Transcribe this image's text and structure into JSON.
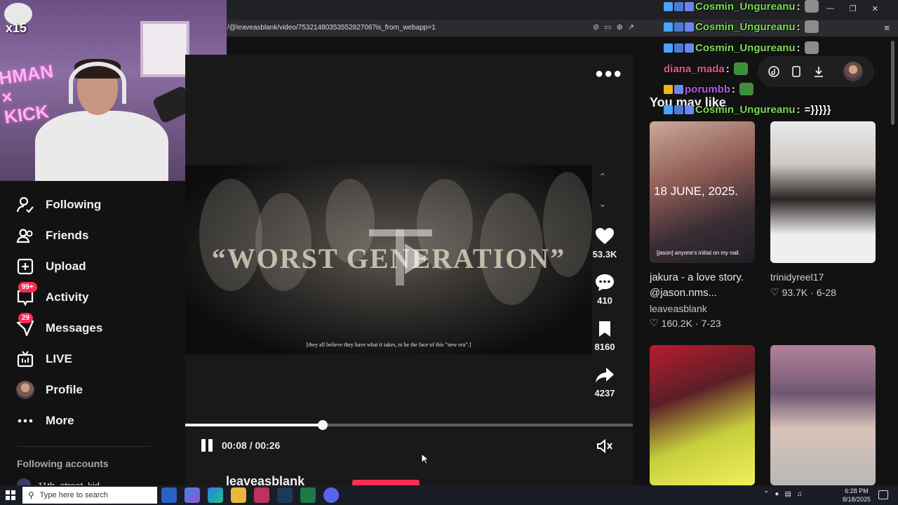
{
  "browser": {
    "url": "/@leaveasblank/video/7532148035355282706?is_from_webapp=1"
  },
  "stream_overlay": {
    "multiplier": "x15"
  },
  "sidebar": {
    "items": [
      {
        "label": "Following"
      },
      {
        "label": "Friends"
      },
      {
        "label": "Upload"
      },
      {
        "label": "Activity",
        "badge": "99+"
      },
      {
        "label": "Messages",
        "badge": "29"
      },
      {
        "label": "LIVE"
      },
      {
        "label": "Profile"
      },
      {
        "label": "More"
      }
    ],
    "following_accounts_title": "Following accounts",
    "following_accounts": [
      {
        "name": "11th_street_kid"
      }
    ]
  },
  "video": {
    "title_overlay": "“WORST GENERATION”",
    "subtitle": "[they all believe they have what it takes, to be the face of this “new era”.]",
    "actions": {
      "likes": "53.3K",
      "comments": "410",
      "saves": "8160",
      "shares": "4237"
    },
    "time": "00:08 / 00:26",
    "progress": 0.3077,
    "author": "leaveasblank"
  },
  "chat": {
    "messages": [
      {
        "user": "Cosmin_Ungureanu",
        "text": "",
        "color": "#7ddc5b"
      },
      {
        "user": "Cosmin_Ungureanu",
        "text": "",
        "color": "#7ddc5b"
      },
      {
        "user": "Cosmin_Ungureanu",
        "text": "",
        "color": "#7ddc5b"
      },
      {
        "user": "diana_mada",
        "text": "",
        "color": "#e25d8a"
      },
      {
        "user": "porumbb",
        "text": "",
        "color": "#b45de3"
      },
      {
        "user": "Cosmin_Ungureanu",
        "text": "=}}}}}",
        "color": "#7ddc5b"
      }
    ]
  },
  "recommendations": {
    "title": "You may like",
    "items": [
      {
        "thumb_caption": "18 JUNE, 2025.",
        "thumb_sub": "[jason] anyone's initial on my nail.",
        "title": "jakura - a love story. @jason.nms...",
        "author": "leaveasblank",
        "likes": "160.2K",
        "date": "7-23"
      },
      {
        "thumb_caption": "",
        "thumb_sub": "",
        "title": "",
        "author": "trinidyreel17",
        "likes": "93.7K",
        "date": "6-28"
      },
      {
        "thumb_caption": "",
        "thumb_sub": "",
        "title": "",
        "author": "",
        "likes": "",
        "date": ""
      },
      {
        "thumb_caption": "",
        "thumb_sub": "",
        "title": "",
        "author": "",
        "likes": "",
        "date": ""
      }
    ]
  },
  "taskbar": {
    "search_placeholder": "Type here to search",
    "time": "6:28 PM",
    "date": "8/18/2025"
  },
  "colors": {
    "accent": "#fe2c55",
    "background": "#121212"
  }
}
